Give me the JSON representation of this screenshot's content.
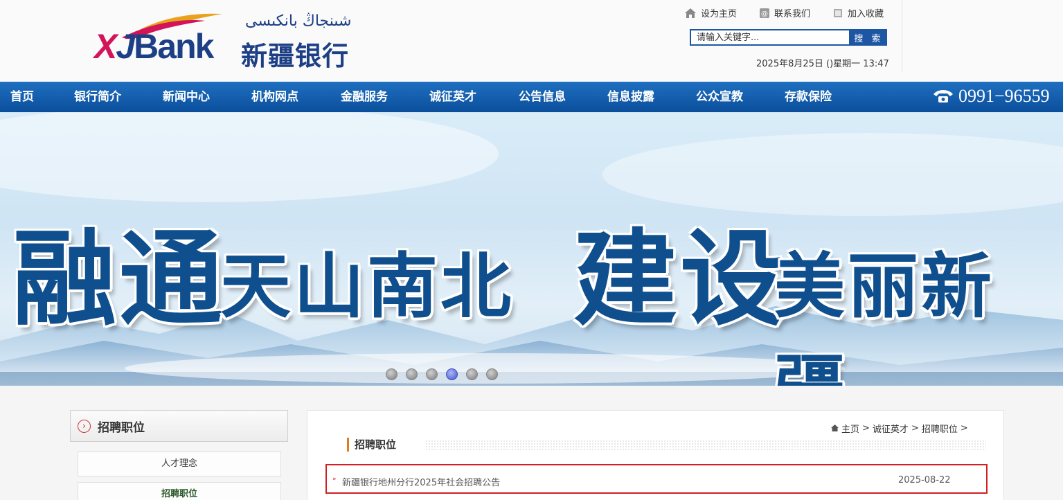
{
  "header": {
    "logo_latin_x": "X",
    "logo_latin_j": "J",
    "logo_latin_bank": "Bank",
    "logo_uyghur": "شىنجاڭ بانكىسى",
    "logo_chinese": "新疆银行",
    "links": [
      {
        "label": "设为主页",
        "icon": "home-icon"
      },
      {
        "label": "联系我们",
        "icon": "contact-icon"
      },
      {
        "label": "加入收藏",
        "icon": "bookmark-icon"
      }
    ],
    "search": {
      "placeholder": "请输入关键字...",
      "button": "搜 索"
    },
    "datetime": "2025年8月25日 ()星期一 13:47"
  },
  "nav": {
    "items": [
      "首页",
      "银行简介",
      "新闻中心",
      "机构网点",
      "金融服务",
      "诚征英才",
      "公告信息",
      "信息披露",
      "公众宣教",
      "存款保险"
    ],
    "phone": "0991−96559"
  },
  "banner": {
    "slogan_big_1": "融通",
    "slogan_small_1": "天山南北",
    "slogan_big_2": "建设",
    "slogan_small_2": "美丽新疆",
    "slide_count": 6,
    "active_slide": 4
  },
  "sidebar": {
    "title": "招聘职位",
    "items": [
      {
        "label": "人才理念",
        "active": false
      },
      {
        "label": "招聘职位",
        "active": true
      }
    ]
  },
  "main": {
    "breadcrumb": [
      "主页",
      "诚征英才",
      "招聘职位"
    ],
    "section_title": "招聘职位",
    "jobs": [
      {
        "title": "新疆银行地州分行2025年社会招聘公告",
        "date": "2025-08-22"
      }
    ]
  },
  "colors": {
    "brand_blue": "#1d57a4",
    "nav_blue": "#0b4f9c",
    "accent_red": "#d11f24",
    "slogan_blue": "#0f4f8e"
  }
}
